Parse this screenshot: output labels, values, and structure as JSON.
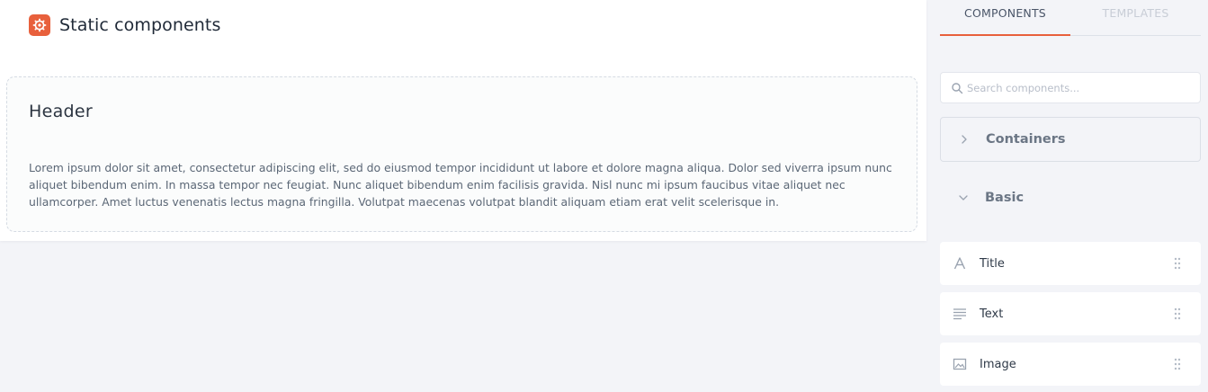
{
  "page": {
    "title": "Static components",
    "section": {
      "header": "Header",
      "text": "Lorem ipsum dolor sit amet, consectetur adipiscing elit, sed do eiusmod tempor incididunt ut labore et dolore magna aliqua. Dolor sed viverra ipsum nunc aliquet bibendum enim. In massa tempor nec feugiat. Nunc aliquet bibendum enim facilisis gravida. Nisl nunc mi ipsum faucibus vitae aliquet nec ullamcorper. Amet luctus venenatis lectus magna fringilla. Volutpat maecenas volutpat blandit aliquam etiam erat velit scelerisque in."
    }
  },
  "panel": {
    "tabs": [
      {
        "label": "COMPONENTS",
        "active": true
      },
      {
        "label": "TEMPLATES",
        "active": false
      }
    ],
    "search": {
      "placeholder": "Search components...",
      "value": ""
    },
    "groups": [
      {
        "label": "Containers",
        "expanded": false
      },
      {
        "label": "Basic",
        "expanded": true
      }
    ],
    "components": [
      {
        "label": "Title",
        "icon": "title-icon"
      },
      {
        "label": "Text",
        "icon": "text-icon"
      },
      {
        "label": "Image",
        "icon": "image-icon"
      }
    ]
  },
  "colors": {
    "accent": "#e8603c",
    "background": "#f3f4f8",
    "canvas": "#ffffff"
  }
}
